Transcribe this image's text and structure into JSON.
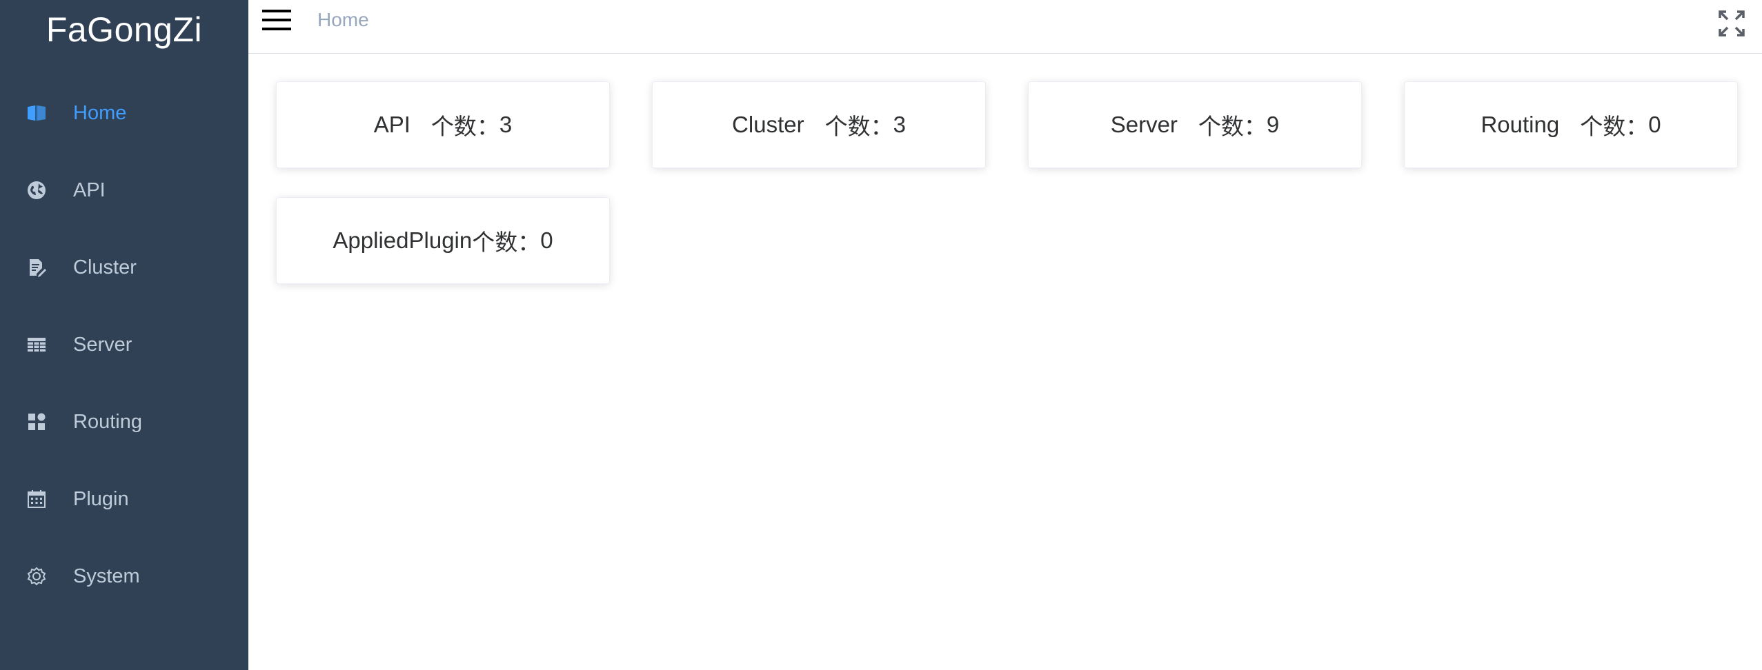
{
  "app": {
    "logo": "FaGongZi"
  },
  "sidebar": {
    "items": [
      {
        "label": "Home",
        "icon": "book-icon",
        "active": true
      },
      {
        "label": "API",
        "icon": "globe-icon"
      },
      {
        "label": "Cluster",
        "icon": "document-edit-icon"
      },
      {
        "label": "Server",
        "icon": "table-icon"
      },
      {
        "label": "Routing",
        "icon": "dashboard-icon"
      },
      {
        "label": "Plugin",
        "icon": "calendar-icon"
      },
      {
        "label": "System",
        "icon": "gear-icon"
      }
    ]
  },
  "navbar": {
    "breadcrumb": "Home",
    "menu_icon": "hamburger-icon",
    "fullscreen_icon": "fullscreen-icon"
  },
  "cards": [
    {
      "name": "API",
      "count_label": "个数：",
      "count": "3"
    },
    {
      "name": "Cluster",
      "count_label": "个数：",
      "count": "3"
    },
    {
      "name": "Server",
      "count_label": "个数：",
      "count": "9"
    },
    {
      "name": "Routing",
      "count_label": "个数：",
      "count": "0"
    },
    {
      "name": "AppliedPlugin",
      "count_label": "个数：",
      "count": "0"
    }
  ],
  "colors": {
    "sidebar_bg": "#304156",
    "sidebar_text": "#bfcbd9",
    "active": "#409eff",
    "breadcrumb": "#97a8be"
  }
}
